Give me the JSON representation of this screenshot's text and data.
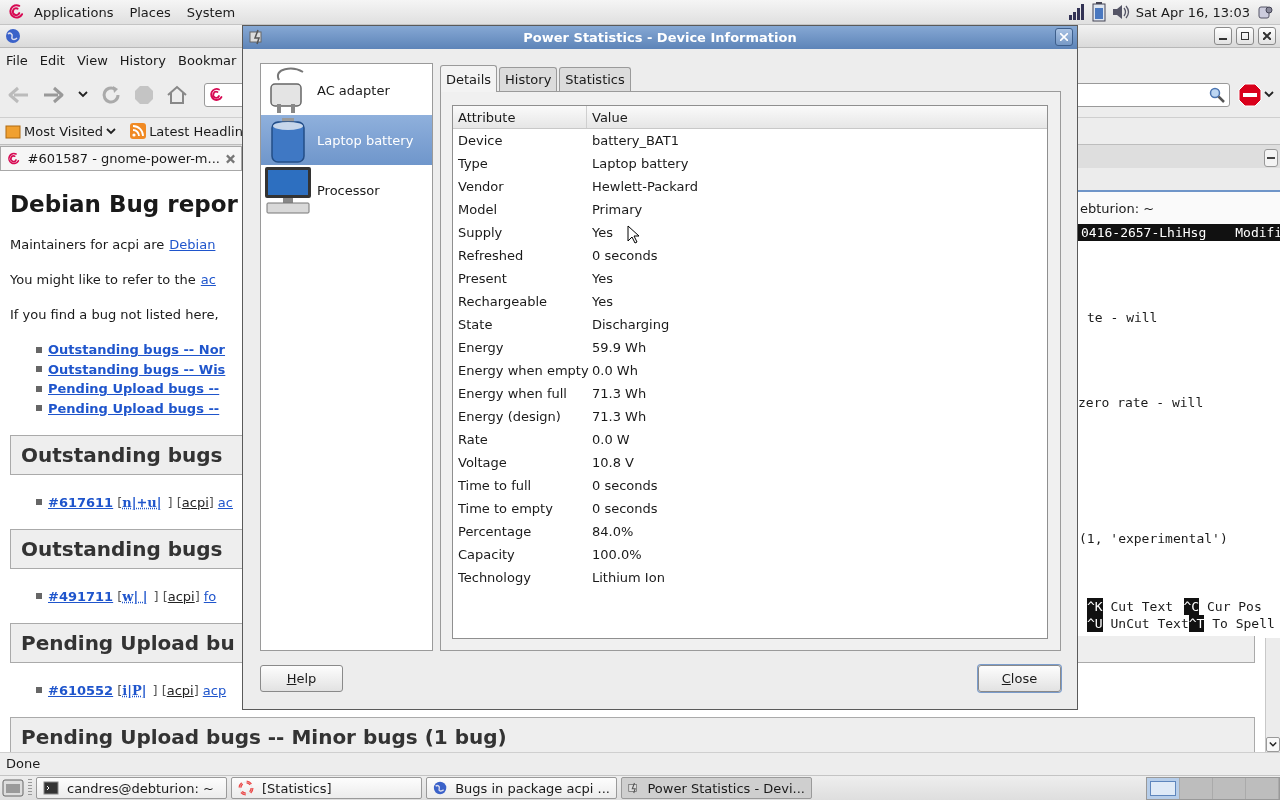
{
  "top_panel": {
    "menus": [
      "Applications",
      "Places",
      "System"
    ],
    "clock": "Sat Apr 16, 13:03"
  },
  "browser": {
    "menu": [
      "File",
      "Edit",
      "View",
      "History",
      "Bookmar"
    ],
    "bookmarks": [
      {
        "label": "Most Visited",
        "kind": "folder"
      },
      {
        "label": "Latest Headlin",
        "kind": "feed"
      }
    ],
    "tabs": [
      {
        "title": "#601587 - gnome-power-m...",
        "selected": true
      }
    ],
    "page": {
      "title": "Debian Bug repor",
      "paragraphs": [
        {
          "text": "Maintainers for acpi are",
          "link": "Debian"
        },
        {
          "text": "You might like to refer to the",
          "link": "ac"
        },
        {
          "text": "If you find a bug not listed here,"
        }
      ],
      "links": [
        "Outstanding bugs -- Nor",
        "Outstanding bugs -- Wis",
        "Pending Upload bugs --",
        "Pending Upload bugs --"
      ],
      "sections": [
        {
          "heading": "Outstanding bugs",
          "bug": {
            "number": "#617611",
            "open": "[",
            "tags": "n|+u|",
            "mid": "] [",
            "package": "acpi",
            "close": "]",
            "title": "ac"
          }
        },
        {
          "heading": "Outstanding bugs",
          "bug": {
            "number": "#491711",
            "open": "[",
            "tags": "w| |",
            "mid": "] [",
            "package": "acpi",
            "close": "]",
            "title": "fo"
          }
        },
        {
          "heading": "Pending Upload bu",
          "bug": {
            "number": "#610552",
            "open": "[",
            "tags": "i|P|",
            "mid": "] [",
            "package": "acpi",
            "close": "]",
            "title": "acp"
          }
        },
        {
          "heading": "Pending Upload bugs -- Minor bugs (1 bug)"
        }
      ]
    },
    "status": "Done"
  },
  "terminal": {
    "title": "ebturion: ~",
    "file": "0416-2657-LhiHsg",
    "state": "Modifi",
    "lines": [
      "te - will",
      "zero rate - will",
      "(1, 'experimental')"
    ],
    "shortcuts": [
      [
        {
          "key": "^K",
          "label": "Cut Text"
        },
        {
          "key": "^C",
          "label": "Cur Pos"
        }
      ],
      [
        {
          "key": "^U",
          "label": "UnCut Text"
        },
        {
          "key": "^T",
          "label": "To Spell"
        }
      ]
    ]
  },
  "dialog": {
    "title": "Power Statistics - Device Information",
    "devices": [
      {
        "label": "AC adapter",
        "kind": "ac",
        "selected": false
      },
      {
        "label": "Laptop battery",
        "kind": "battery",
        "selected": true
      },
      {
        "label": "Processor",
        "kind": "cpu",
        "selected": false
      }
    ],
    "tabs": [
      {
        "label": "Details",
        "selected": true
      },
      {
        "label": "History",
        "selected": false
      },
      {
        "label": "Statistics",
        "selected": false
      }
    ],
    "columns": [
      "Attribute",
      "Value"
    ],
    "rows": [
      [
        "Device",
        "battery_BAT1"
      ],
      [
        "Type",
        "Laptop battery"
      ],
      [
        "Vendor",
        "Hewlett-Packard"
      ],
      [
        "Model",
        "Primary"
      ],
      [
        "Supply",
        "Yes"
      ],
      [
        "Refreshed",
        "0 seconds"
      ],
      [
        "Present",
        "Yes"
      ],
      [
        "Rechargeable",
        "Yes"
      ],
      [
        "State",
        "Discharging"
      ],
      [
        "Energy",
        "59.9 Wh"
      ],
      [
        "Energy when empty",
        "0.0 Wh"
      ],
      [
        "Energy when full",
        "71.3 Wh"
      ],
      [
        "Energy (design)",
        "71.3 Wh"
      ],
      [
        "Rate",
        "0.0 W"
      ],
      [
        "Voltage",
        "10.8 V"
      ],
      [
        "Time to full",
        "0 seconds"
      ],
      [
        "Time to empty",
        "0 seconds"
      ],
      [
        "Percentage",
        "84.0%"
      ],
      [
        "Capacity",
        "100.0%"
      ],
      [
        "Technology",
        "Lithium Ion"
      ]
    ],
    "buttons": [
      "Help",
      "Close"
    ]
  },
  "taskbar": {
    "tasks": [
      {
        "label": "candres@debturion: ~",
        "kind": "terminal",
        "selected": false
      },
      {
        "label": "[Statistics]",
        "kind": "help",
        "selected": false
      },
      {
        "label": "Bugs in package acpi ...",
        "kind": "browser",
        "selected": false
      },
      {
        "label": "Power Statistics - Devi...",
        "kind": "power",
        "selected": true
      }
    ],
    "workspaces": [
      {
        "selected": true
      },
      {
        "selected": false
      },
      {
        "selected": false
      },
      {
        "selected": false
      }
    ]
  }
}
